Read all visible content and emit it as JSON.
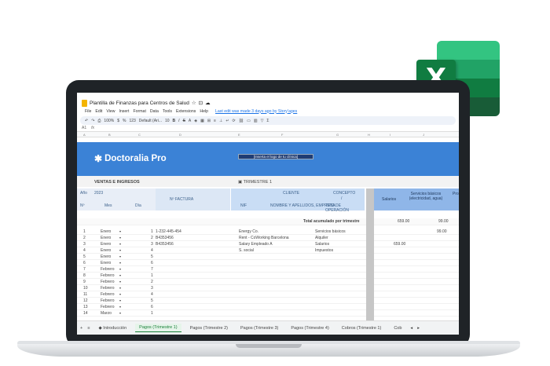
{
  "doc": {
    "title": "Plantilla de Finanzas para Centros de Salud",
    "last_edit": "Last edit was made 3 days ago by Story'ages"
  },
  "menu": [
    "File",
    "Edit",
    "View",
    "Insert",
    "Format",
    "Data",
    "Tools",
    "Extensions",
    "Help"
  ],
  "toolbar": {
    "zoom": "100%",
    "currency": "$",
    "percent": "%",
    "number_fmt": "123",
    "font": "Default (Ari...",
    "size": "10"
  },
  "formula": {
    "cell": "A1",
    "fx": "fx"
  },
  "columns": [
    "A",
    "B",
    "C",
    "D",
    "E",
    "F",
    "G",
    "H",
    "I",
    "J"
  ],
  "banner": {
    "brand": "Doctoralia Pro",
    "logo_placeholder": "[Inserta el logo de tu clínica]"
  },
  "section": {
    "title": "VENTAS E INGRESOS",
    "quarter": "TRIMESTRE 1"
  },
  "headers": {
    "year_label": "Año",
    "year": "2023",
    "num": "Nº",
    "month": "Mes",
    "day": "Día",
    "invoice": "Nº FACTURA",
    "client": "CLIENTE",
    "nif": "NIF",
    "client_name": "NOMBRE Y APELLIDOS, EMPRESA",
    "concept": "CONCEPTO",
    "slash": "/",
    "op_type": "TIPO DE OPERACIÓN",
    "salaries": "Salarios",
    "services": "Servicios básicos (electricidad, agua)",
    "pro": "Pro"
  },
  "totals": {
    "label": "Total acumulado por trimestre",
    "salaries": "659.00",
    "services": "99.00"
  },
  "rows": [
    {
      "n": "1",
      "mes": "Enero",
      "dia": "1",
      "factura": "1-232-445-454",
      "cliente": "Energy Co.",
      "concepto": "Servicios básicos",
      "sal": "",
      "serv": "99.00"
    },
    {
      "n": "2",
      "mes": "Enero",
      "dia": "2",
      "factura": "B4353456",
      "cliente": "Rent - CoWorking Barcelona",
      "concepto": "Alquiler",
      "sal": "",
      "serv": ""
    },
    {
      "n": "3",
      "mes": "Enero",
      "dia": "3",
      "factura": "B4353456",
      "cliente": "Salary Empleado A",
      "concepto": "Salarios",
      "sal": "659.00",
      "serv": ""
    },
    {
      "n": "4",
      "mes": "Enero",
      "dia": "4",
      "factura": "",
      "cliente": "S. social",
      "concepto": "Impuestos",
      "sal": "",
      "serv": ""
    },
    {
      "n": "5",
      "mes": "Enero",
      "dia": "5",
      "factura": "",
      "cliente": "",
      "concepto": "",
      "sal": "",
      "serv": ""
    },
    {
      "n": "6",
      "mes": "Enero",
      "dia": "6",
      "factura": "",
      "cliente": "",
      "concepto": "",
      "sal": "",
      "serv": ""
    },
    {
      "n": "7",
      "mes": "Febrero",
      "dia": "7",
      "factura": "",
      "cliente": "",
      "concepto": "",
      "sal": "",
      "serv": ""
    },
    {
      "n": "8",
      "mes": "Febrero",
      "dia": "1",
      "factura": "",
      "cliente": "",
      "concepto": "",
      "sal": "",
      "serv": ""
    },
    {
      "n": "9",
      "mes": "Febrero",
      "dia": "2",
      "factura": "",
      "cliente": "",
      "concepto": "",
      "sal": "",
      "serv": ""
    },
    {
      "n": "10",
      "mes": "Febrero",
      "dia": "3",
      "factura": "",
      "cliente": "",
      "concepto": "",
      "sal": "",
      "serv": ""
    },
    {
      "n": "11",
      "mes": "Febrero",
      "dia": "4",
      "factura": "",
      "cliente": "",
      "concepto": "",
      "sal": "",
      "serv": ""
    },
    {
      "n": "12",
      "mes": "Febrero",
      "dia": "5",
      "factura": "",
      "cliente": "",
      "concepto": "",
      "sal": "",
      "serv": ""
    },
    {
      "n": "13",
      "mes": "Febrero",
      "dia": "6",
      "factura": "",
      "cliente": "",
      "concepto": "",
      "sal": "",
      "serv": ""
    },
    {
      "n": "14",
      "mes": "Marzo",
      "dia": "1",
      "factura": "",
      "cliente": "",
      "concepto": "",
      "sal": "",
      "serv": ""
    }
  ],
  "tabs": [
    "Introducción",
    "Pagos (Trimestre 1)",
    "Pagos (Trimestre 2)",
    "Pagos (Trimestre 3)",
    "Pagos (Trimestre 4)",
    "Cobros (Trimestre 1)",
    "Cob"
  ],
  "colors": {
    "excel_green": "#107c41",
    "banner_blue": "#3b82d6",
    "header_blue": "#c9ddf5",
    "sheets_green": "#188038"
  }
}
